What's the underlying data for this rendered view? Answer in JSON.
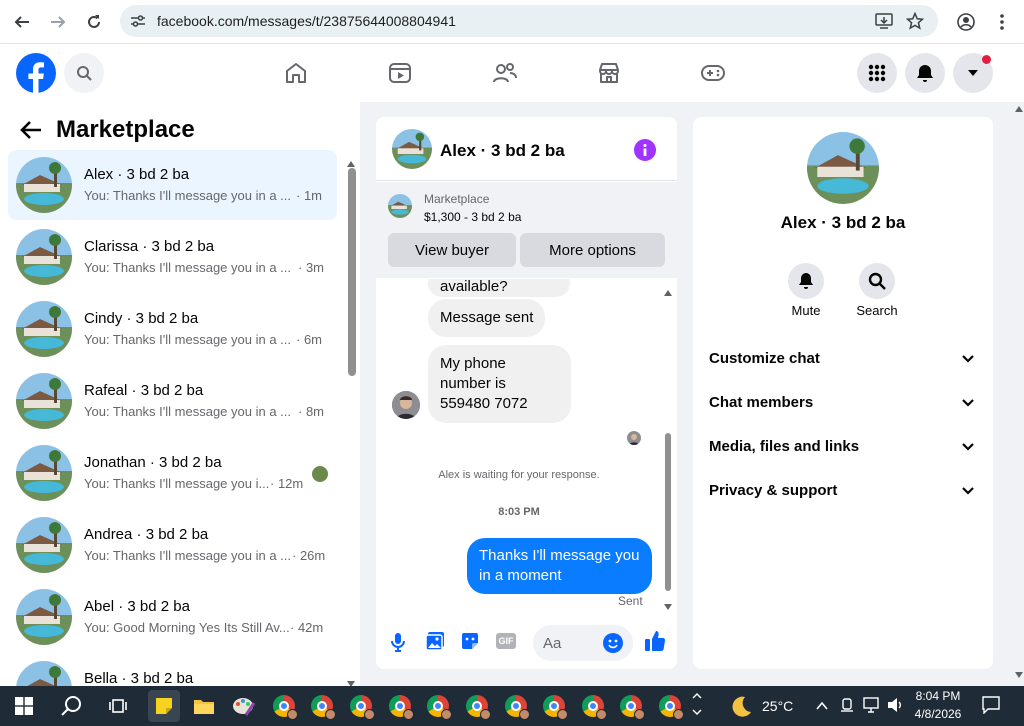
{
  "browser": {
    "url": "facebook.com/messages/t/23875644008804941"
  },
  "left_panel": {
    "title": "Marketplace",
    "conversations": [
      {
        "name": "Alex · 3 bd 2 ba",
        "preview": "You: Thanks I'll message you in a ...",
        "time": "· 1m"
      },
      {
        "name": "Clarissa · 3 bd 2 ba",
        "preview": "You: Thanks I'll message you in a ...",
        "time": "· 3m"
      },
      {
        "name": "Cindy · 3 bd 2 ba",
        "preview": "You: Thanks I'll message you in a ...",
        "time": "· 6m"
      },
      {
        "name": "Rafeal · 3 bd 2 ba",
        "preview": "You: Thanks I'll message you in a ...",
        "time": "· 8m"
      },
      {
        "name": "Jonathan · 3 bd 2 ba",
        "preview": "You: Thanks I'll message you i...",
        "time": "· 12m"
      },
      {
        "name": "Andrea · 3 bd 2 ba",
        "preview": "You: Thanks I'll message you in a ...",
        "time": "· 26m"
      },
      {
        "name": "Abel · 3 bd 2 ba",
        "preview": "You: Good Morning Yes Its Still Av...",
        "time": "· 42m"
      },
      {
        "name": "Bella · 3 bd 2 ba",
        "preview": "",
        "time": ""
      }
    ]
  },
  "chat": {
    "title": "Alex · 3 bd 2 ba",
    "listing_source": "Marketplace",
    "listing_price": "$1,300 - 3 bd 2 ba",
    "view_buyer": "View buyer",
    "more_options": "More options",
    "msg_partial": "available?",
    "msg_sent": "Message sent",
    "msg_phone": "My phone number is 559480 7072",
    "waiting": "Alex is waiting for your response.",
    "time": "8:03 PM",
    "my_message": "Thanks I'll message you in a moment",
    "sent_status": "Sent",
    "composer_placeholder": "Aa",
    "gif_label": "GIF"
  },
  "info_panel": {
    "name": "Alex · 3 bd 2 ba",
    "mute": "Mute",
    "search": "Search",
    "sections": [
      "Customize chat",
      "Chat members",
      "Media, files and links",
      "Privacy & support"
    ]
  },
  "taskbar": {
    "weather": "25°C",
    "time": "8:04 PM",
    "date": "4/8/2026"
  },
  "colors": {
    "facebook_blue": "#0866ff",
    "messenger_purple": "#a033ff",
    "selected_row": "#ebf5ff"
  }
}
